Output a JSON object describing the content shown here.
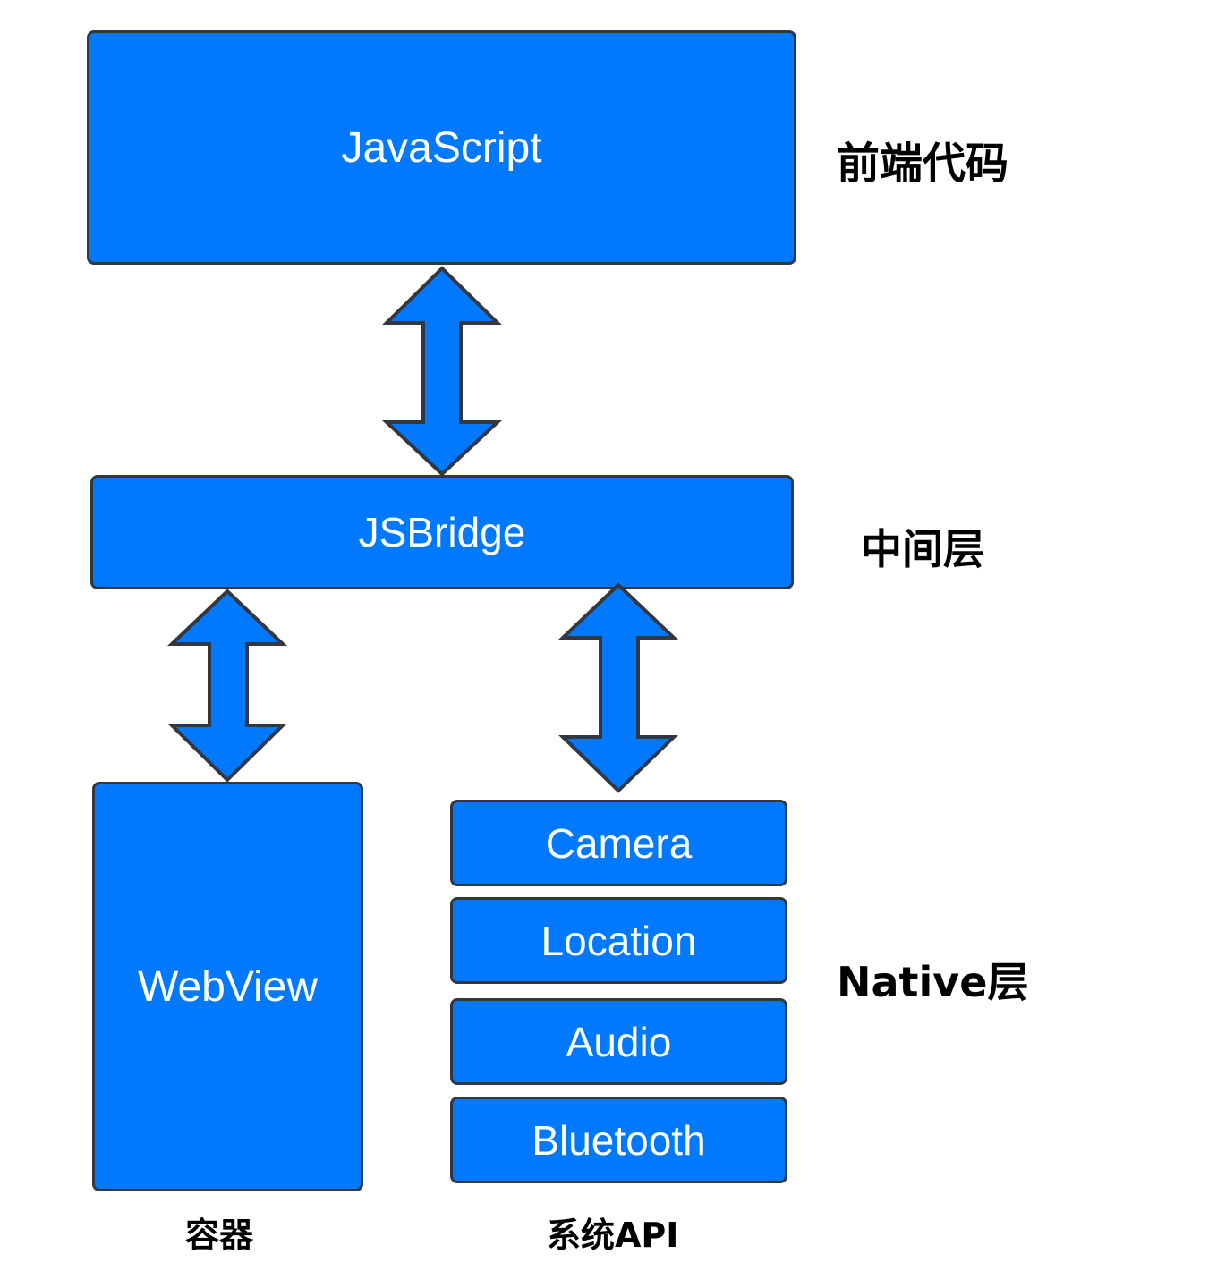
{
  "colors": {
    "box_fill": "#0079FF",
    "box_border": "#333740",
    "box_text": "#FFFFFF",
    "label_text": "#000000"
  },
  "layers": {
    "frontend": {
      "label": "前端代码",
      "boxes": {
        "javascript": "JavaScript"
      }
    },
    "middle": {
      "label": "中间层",
      "boxes": {
        "jsbridge": "JSBridge"
      }
    },
    "native": {
      "label": "Native层",
      "container": {
        "box": "WebView",
        "caption": "容器"
      },
      "system_api": {
        "caption": "系统API",
        "items": [
          "Camera",
          "Location",
          "Audio",
          "Bluetooth"
        ]
      }
    }
  },
  "connections": [
    {
      "from": "JavaScript",
      "to": "JSBridge",
      "type": "bidirectional"
    },
    {
      "from": "JSBridge",
      "to": "WebView",
      "type": "bidirectional"
    },
    {
      "from": "JSBridge",
      "to": "系统API",
      "type": "bidirectional"
    }
  ]
}
